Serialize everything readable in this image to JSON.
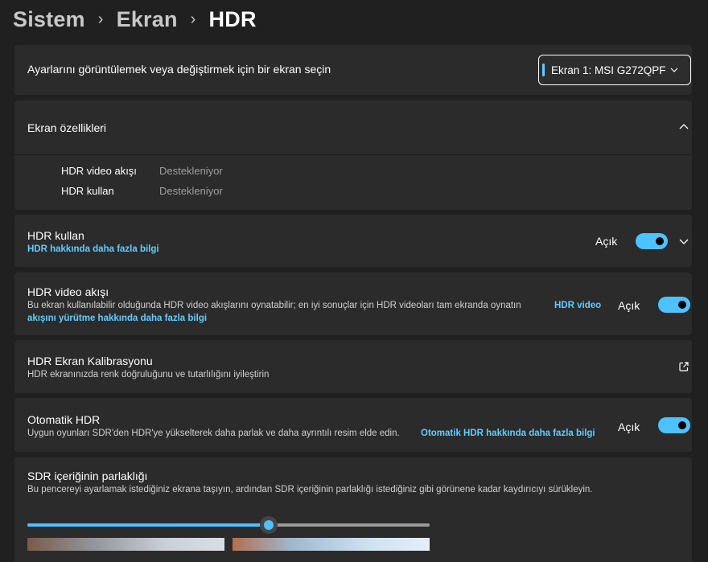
{
  "breadcrumb": {
    "items": [
      "Sistem",
      "Ekran",
      "HDR"
    ],
    "separator": "›"
  },
  "display_select": {
    "prompt": "Ayarlarını görüntülemek veya değiştirmek için bir ekran seçin",
    "value": "Ekran 1: MSI G272QPF"
  },
  "display_properties": {
    "title": "Ekran özellikleri",
    "rows": [
      {
        "label": "HDR video akışı",
        "value": "Destekleniyor"
      },
      {
        "label": "HDR kullan",
        "value": "Destekleniyor"
      }
    ]
  },
  "use_hdr": {
    "title": "HDR kullan",
    "link": "HDR hakkında daha fazla bilgi",
    "state": "Açık",
    "on": true
  },
  "hdr_video": {
    "title": "HDR video akışı",
    "desc": "Bu ekran kullanılabilir olduğunda HDR video akışlarını oynatabilir; en iyi sonuçlar için HDR videoları tam ekranda oynatın",
    "link_line1": "HDR video",
    "link_line2": "akışını yürütme hakkında daha fazla bilgi",
    "state": "Açık",
    "on": true
  },
  "calibration": {
    "title": "HDR Ekran Kalibrasyonu",
    "desc": "HDR ekranınızda renk doğruluğunu ve tutarlılığını iyileştirin"
  },
  "auto_hdr": {
    "title": "Otomatik HDR",
    "desc": "Uygun oyunları SDR'den HDR'ye yükselterek daha parlak ve daha ayrıntılı resim elde edin.",
    "link": "Otomatik HDR hakkında daha fazla bilgi",
    "state": "Açık",
    "on": true
  },
  "sdr_brightness": {
    "title": "SDR içeriğinin parlaklığı",
    "desc": "Bu pencereyi ayarlamak istediğiniz ekrana taşıyın, ardından SDR içeriğinin parlaklığı istediğiniz gibi görünene kadar kaydırıcıyı sürükleyin.",
    "slider_fraction": 0.6
  },
  "colors": {
    "accent": "#4cc2ff",
    "link": "#60cdff",
    "card": "#2b2b2b",
    "background": "#202020"
  },
  "icons": [
    "chevron-down-icon",
    "chevron-up-icon",
    "external-link-icon"
  ]
}
